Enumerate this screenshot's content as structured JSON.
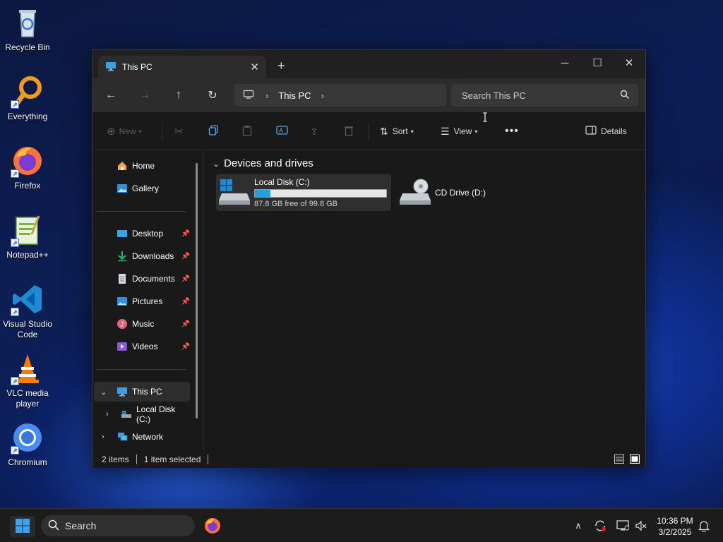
{
  "desktop": {
    "icons": [
      {
        "label": "Recycle Bin"
      },
      {
        "label": "Everything"
      },
      {
        "label": "Firefox"
      },
      {
        "label": "Notepad++"
      },
      {
        "label": "Visual Studio Code"
      },
      {
        "label": "VLC media player"
      },
      {
        "label": "Chromium"
      }
    ]
  },
  "window": {
    "tab_title": "This PC",
    "new_tab_symbol": "+",
    "address": {
      "location": "This PC"
    },
    "search": {
      "placeholder": "Search This PC"
    },
    "toolbar": {
      "new_label": "New",
      "sort_label": "Sort",
      "view_label": "View",
      "details_label": "Details"
    },
    "sidebar": {
      "quick_items": [
        {
          "label": "Home"
        },
        {
          "label": "Gallery"
        }
      ],
      "pinned_items": [
        {
          "label": "Desktop"
        },
        {
          "label": "Downloads"
        },
        {
          "label": "Documents"
        },
        {
          "label": "Pictures"
        },
        {
          "label": "Music"
        },
        {
          "label": "Videos"
        }
      ],
      "tree": {
        "this_pc": "This PC",
        "local_disk": "Local Disk (C:)",
        "network": "Network"
      }
    },
    "content": {
      "group_title": "Devices and drives",
      "drives": [
        {
          "name": "Local Disk (C:)",
          "free_text": "87.8 GB free of 99.8 GB",
          "used_fraction": 0.12
        },
        {
          "name": "CD Drive (D:)"
        }
      ]
    },
    "status": {
      "items": "2 items",
      "selected": "1 item selected"
    }
  },
  "taskbar": {
    "search_label": "Search",
    "time": "10:36 PM",
    "date": "3/2/2025"
  },
  "colors": {
    "accent": "#26a0da",
    "window_bg": "#191919",
    "taskbar_bg": "#1c1c1c"
  }
}
